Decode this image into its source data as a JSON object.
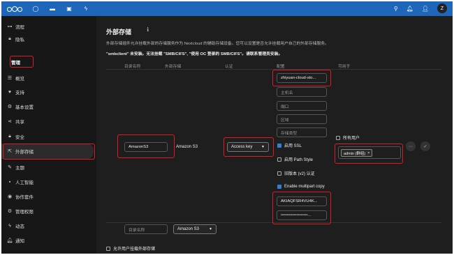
{
  "topbar": {
    "avatar_letter": "Z"
  },
  "sidebar": {
    "items": [
      {
        "label": "流程",
        "icon": "flow-icon"
      },
      {
        "label": "隐私",
        "icon": "lock-icon"
      },
      {
        "label": "管理",
        "icon": ""
      },
      {
        "label": "概览",
        "icon": "list-icon"
      },
      {
        "label": "支持",
        "icon": "heart-icon"
      },
      {
        "label": "基本设置",
        "icon": "gear-icon"
      },
      {
        "label": "共享",
        "icon": "share-icon"
      },
      {
        "label": "安全",
        "icon": "lock-icon"
      },
      {
        "label": "外部存储",
        "icon": "external-icon"
      },
      {
        "label": "主题",
        "icon": "brush-icon"
      },
      {
        "label": "人工智能",
        "icon": "ai-icon"
      },
      {
        "label": "协作套件",
        "icon": "docs-icon"
      },
      {
        "label": "管理权限",
        "icon": "gear-icon"
      },
      {
        "label": "动态",
        "icon": "bolt-icon"
      },
      {
        "label": "通知",
        "icon": "bell-icon"
      }
    ]
  },
  "main": {
    "title": "外部存储",
    "info_glyph": "ℹ",
    "description": "外部存储插件允许挂载外部的存储服务作为 Nextcloud 的辅助存储设备。您可以设置是否允许挂载用户自己的外部存储服务。",
    "warning": "\"smbclient\" 未安装。无法挂载 \"SMB/CIFS\", \"使用 OC 登录的 SMB/CIFS\"。请联系管理员安装。",
    "headers": {
      "folder": "目录名称",
      "storage": "外部存储",
      "auth": "认证",
      "config": "配置",
      "available": "可用于"
    },
    "row": {
      "folder_name": "AmazonS3",
      "storage_type": "Amazon S3",
      "auth_method": "Access key",
      "config": {
        "bucket": "zhiyuan-cloud-sto...",
        "hostname_placeholder": "主机名",
        "port_placeholder": "端口",
        "region_placeholder": "区域",
        "storage_class_placeholder": "存储类型",
        "enable_ssl": "启用 SSL",
        "enable_path_style": "启用 Path Style",
        "legacy_auth": "旧版本 (v2) 认证",
        "enable_multipart": "Enable multipart copy",
        "access_key": "AKIAQFSR4VU4K...",
        "secret_key": "•••••••••••••••••••..."
      },
      "all_users_label": "所有用户",
      "applicable_chip": "admin (群组)",
      "chip_remove": "×",
      "more_glyph": "⋯",
      "save_glyph": "✓"
    },
    "new_row": {
      "folder_placeholder": "目录名称",
      "storage_select": "Amazon S3"
    },
    "allow_user_mount": "允许用户挂载外部存储"
  }
}
